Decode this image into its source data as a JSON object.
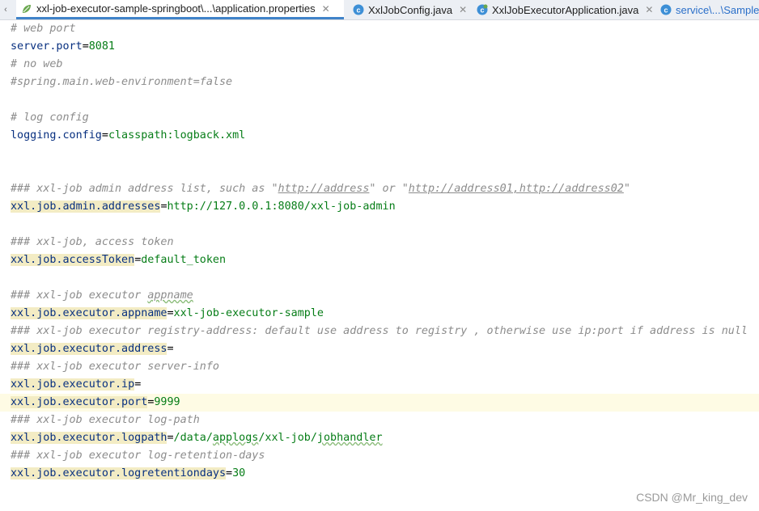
{
  "tabs": [
    {
      "label": "xxl-job-executor-sample-springboot\\...\\application.properties",
      "icon": "spring-leaf-icon",
      "active": true
    },
    {
      "label": "XxlJobConfig.java",
      "icon": "java-class-icon",
      "active": false
    },
    {
      "label": "XxlJobExecutorApplication.java",
      "icon": "spring-boot-class-icon",
      "active": false
    },
    {
      "label": "service\\...\\Sample",
      "icon": "java-class-icon",
      "active": false
    }
  ],
  "editor": {
    "lines": {
      "l1": {
        "comment": "# web port"
      },
      "l2": {
        "key": "server.port",
        "eq": "=",
        "value": "8081"
      },
      "l3": {
        "comment": "# no web"
      },
      "l4": {
        "comment": "#spring.main.web-environment=false"
      },
      "l6": {
        "comment": "# log config"
      },
      "l7": {
        "key": "logging.config",
        "eq": "=",
        "value": "classpath:logback.xml"
      },
      "l10": {
        "c1": "### xxl-job admin address list, such as \"",
        "link1": "http://address",
        "c2": "\" or \"",
        "link2": "http://address01,http://address02",
        "c3": "\""
      },
      "l11": {
        "key": "xxl.job.admin.addresses",
        "eq": "=",
        "value": "http://127.0.0.1:8080/xxl-job-admin"
      },
      "l13": {
        "comment": "### xxl-job, access token"
      },
      "l14": {
        "key": "xxl.job.accessToken",
        "eq": "=",
        "value": "default_token"
      },
      "l16": {
        "c1": "### xxl-job executor ",
        "wavy": "appname"
      },
      "l17": {
        "key": "xxl.job.executor.appname",
        "eq": "=",
        "value": "xxl-job-executor-sample"
      },
      "l18": {
        "comment": "### xxl-job executor registry-address: default use address to registry , otherwise use ip:port if address is null"
      },
      "l19": {
        "key": "xxl.job.executor.address",
        "eq": "=",
        "value": ""
      },
      "l20": {
        "comment": "### xxl-job executor server-info"
      },
      "l21": {
        "key": "xxl.job.executor.ip",
        "eq": "=",
        "value": ""
      },
      "l22": {
        "key": "xxl.job.executor.port",
        "eq": "=",
        "value": "9999"
      },
      "l23": {
        "comment": "### xxl-job executor log-path"
      },
      "l24": {
        "key": "xxl.job.executor.logpath",
        "eq": "=",
        "value1": "/data/",
        "valuewavy": "applogs",
        "value2": "/xxl-job/",
        "valuewavy2": "jobhandler"
      },
      "l25": {
        "comment": "### xxl-job executor log-retention-days"
      },
      "l26": {
        "key": "xxl.job.executor.logretentiondays",
        "eq": "=",
        "value": "30"
      }
    }
  },
  "watermark": "CSDN @Mr_king_dev",
  "colors": {
    "comment": "#8c8c8c",
    "key": "#083080",
    "value": "#067d17",
    "key_highlight_bg": "#f3ecc4",
    "current_line_bg": "#fefbe4",
    "active_tab_underline": "#4083c9"
  }
}
